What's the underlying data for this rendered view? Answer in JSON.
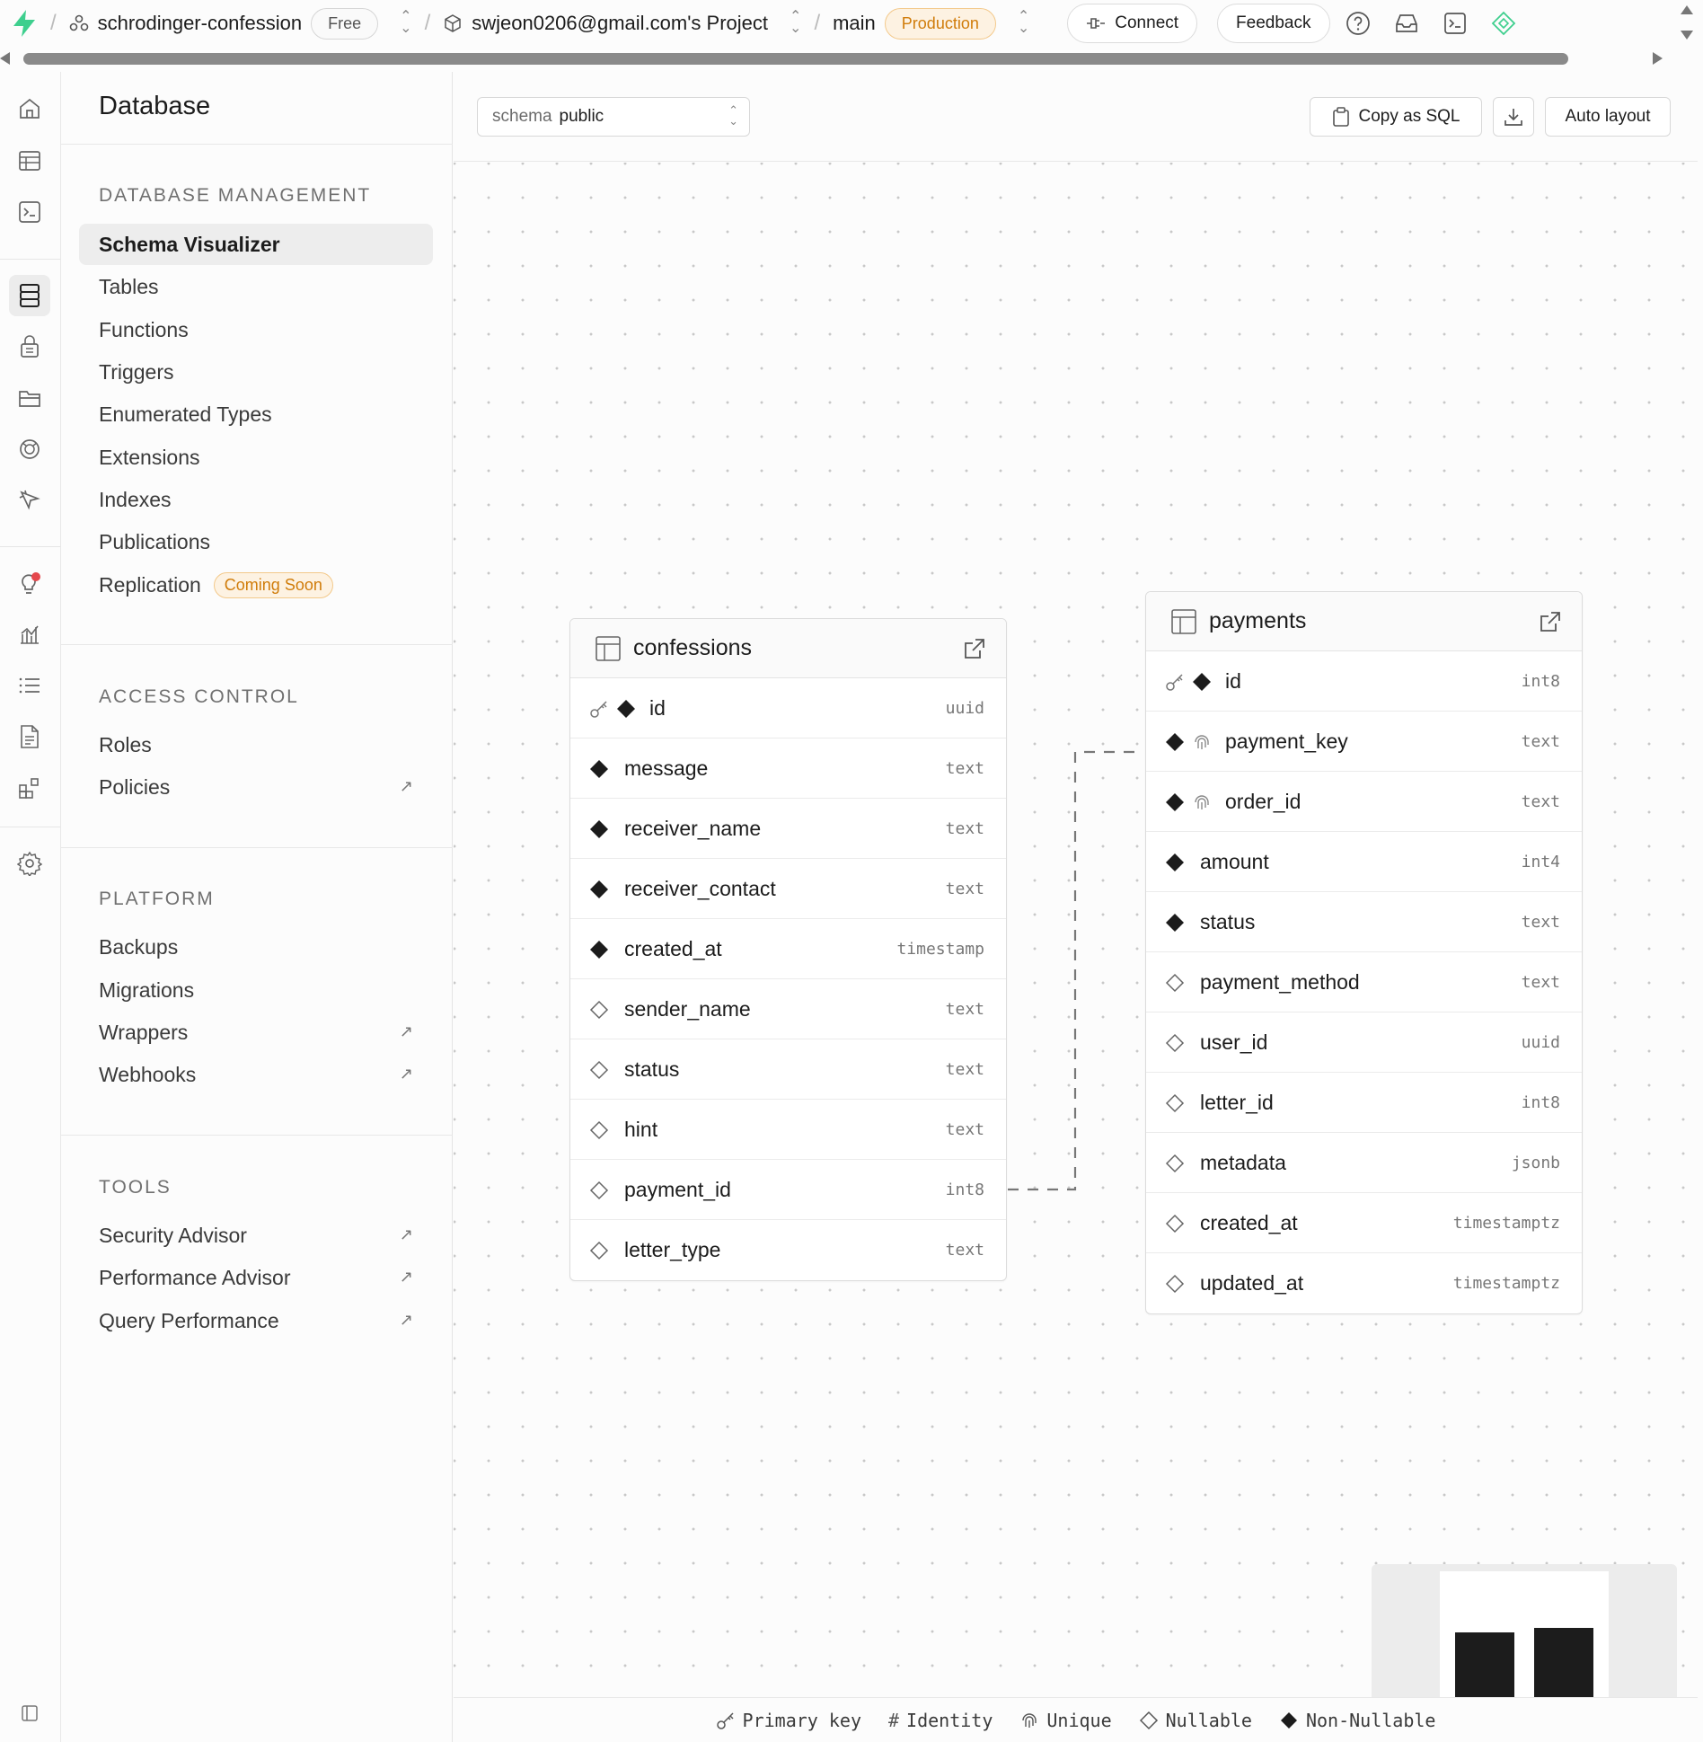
{
  "topbar": {
    "org": "schrodinger-confession",
    "plan": "Free",
    "project": "swjeon0206@gmail.com's Project",
    "branch": "main",
    "env": "Production",
    "connect": "Connect",
    "feedback": "Feedback"
  },
  "sidebar": {
    "title": "Database",
    "sections": [
      {
        "title": "DATABASE MANAGEMENT",
        "items": [
          "Schema Visualizer",
          "Tables",
          "Functions",
          "Triggers",
          "Enumerated Types",
          "Extensions",
          "Indexes",
          "Publications",
          "Replication"
        ]
      },
      {
        "title": "ACCESS CONTROL",
        "items": [
          "Roles",
          "Policies"
        ]
      },
      {
        "title": "PLATFORM",
        "items": [
          "Backups",
          "Migrations",
          "Wrappers",
          "Webhooks"
        ]
      },
      {
        "title": "TOOLS",
        "items": [
          "Security Advisor",
          "Performance Advisor",
          "Query Performance"
        ]
      }
    ],
    "coming_soon": "Coming Soon"
  },
  "toolbar": {
    "schema_label": "schema",
    "schema_value": "public",
    "copy_sql": "Copy as SQL",
    "auto_layout": "Auto layout"
  },
  "tables": {
    "confessions": {
      "name": "confessions",
      "columns": [
        {
          "name": "id",
          "type": "uuid",
          "pk": true,
          "nullable": false
        },
        {
          "name": "message",
          "type": "text",
          "nullable": false
        },
        {
          "name": "receiver_name",
          "type": "text",
          "nullable": false
        },
        {
          "name": "receiver_contact",
          "type": "text",
          "nullable": false
        },
        {
          "name": "created_at",
          "type": "timestamp",
          "nullable": false
        },
        {
          "name": "sender_name",
          "type": "text",
          "nullable": true
        },
        {
          "name": "status",
          "type": "text",
          "nullable": true
        },
        {
          "name": "hint",
          "type": "text",
          "nullable": true
        },
        {
          "name": "payment_id",
          "type": "int8",
          "nullable": true
        },
        {
          "name": "letter_type",
          "type": "text",
          "nullable": true
        }
      ]
    },
    "payments": {
      "name": "payments",
      "columns": [
        {
          "name": "id",
          "type": "int8",
          "pk": true,
          "nullable": false
        },
        {
          "name": "payment_key",
          "type": "text",
          "unique": true,
          "nullable": false
        },
        {
          "name": "order_id",
          "type": "text",
          "unique": true,
          "nullable": false
        },
        {
          "name": "amount",
          "type": "int4",
          "nullable": false
        },
        {
          "name": "status",
          "type": "text",
          "nullable": false
        },
        {
          "name": "payment_method",
          "type": "text",
          "nullable": true
        },
        {
          "name": "user_id",
          "type": "uuid",
          "nullable": true
        },
        {
          "name": "letter_id",
          "type": "int8",
          "nullable": true
        },
        {
          "name": "metadata",
          "type": "jsonb",
          "nullable": true
        },
        {
          "name": "created_at",
          "type": "timestamptz",
          "nullable": true
        },
        {
          "name": "updated_at",
          "type": "timestamptz",
          "nullable": true
        }
      ]
    }
  },
  "legend": {
    "primary_key": "Primary key",
    "identity": "Identity",
    "unique": "Unique",
    "nullable": "Nullable",
    "non_nullable": "Non-Nullable"
  },
  "colors": {
    "brand": "#3ecf8e",
    "production": "#d07c0a",
    "notification": "#e5484d"
  }
}
